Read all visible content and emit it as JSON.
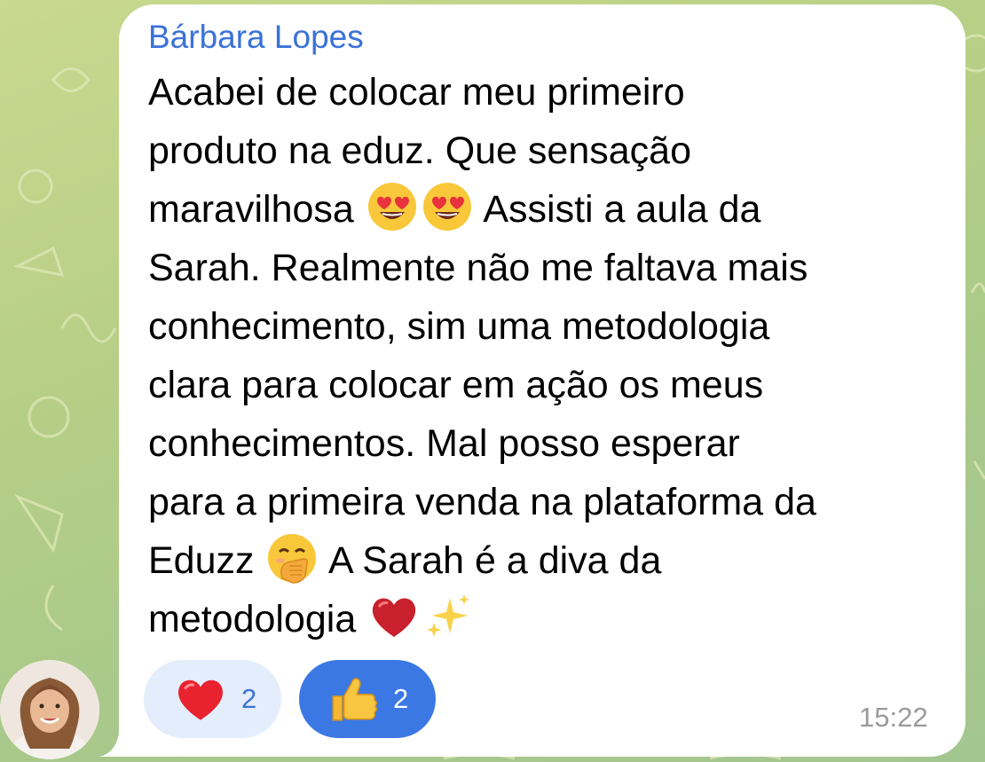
{
  "chat": {
    "background_color": "#b7cf86",
    "bubble_color": "#ffffff",
    "accent_color": "#3a72d8"
  },
  "message": {
    "sender": "Bárbara Lopes",
    "lines": {
      "l1": "Acabei de colocar meu primeiro",
      "l2": "produto na eduz. Que sensação",
      "l3a": "maravilhosa",
      "l3b": "Assisti a aula da",
      "l4": "Sarah. Realmente não me faltava mais",
      "l5": "conhecimento, sim uma metodologia",
      "l6": "clara para colocar em ação os meus",
      "l7": "conhecimentos. Mal posso esperar",
      "l8": "para a primeira venda na plataforma da",
      "l9a": "Eduzz",
      "l9b": "A Sarah é a diva da",
      "l10": "metodologia"
    },
    "emojis": [
      "heart-eyes-emoji",
      "heart-eyes-emoji",
      "hand-over-mouth-emoji",
      "red-heart-emoji",
      "sparkles-emoji"
    ],
    "time": "15:22"
  },
  "reactions": [
    {
      "icon": "red-heart-icon",
      "count": "2",
      "selected": false
    },
    {
      "icon": "thumbs-up-icon",
      "count": "2",
      "selected": true
    }
  ]
}
